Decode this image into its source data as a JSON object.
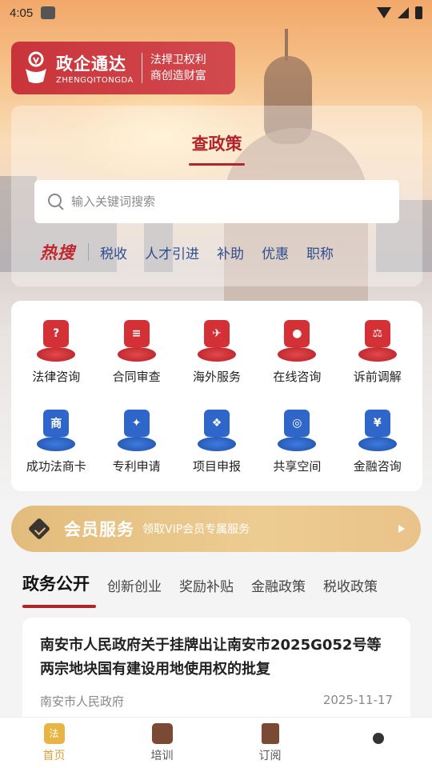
{
  "status": {
    "time": "4:05"
  },
  "logo": {
    "title": "政企通达",
    "pinyin": "ZHENGQITONGDA",
    "slogan_1": "法捍卫权利",
    "slogan_2": "商创造财富"
  },
  "policy": {
    "title": "查政策",
    "search_placeholder": "输入关键词搜索",
    "hot_label": "热搜",
    "hot_items": [
      "税收",
      "人才引进",
      "补助",
      "优惠",
      "职称"
    ]
  },
  "services": [
    {
      "label": "法律咨询",
      "icon": "law-consult-icon",
      "color": "red",
      "glyph": "?"
    },
    {
      "label": "合同审查",
      "icon": "contract-review-icon",
      "color": "red",
      "glyph": "≡"
    },
    {
      "label": "海外服务",
      "icon": "overseas-plane-icon",
      "color": "red",
      "glyph": "✈"
    },
    {
      "label": "在线咨询",
      "icon": "online-consult-icon",
      "color": "red",
      "glyph": "●"
    },
    {
      "label": "诉前调解",
      "icon": "gavel-icon",
      "color": "red",
      "glyph": "⚖"
    },
    {
      "label": "成功法商卡",
      "icon": "merchant-card-icon",
      "color": "blue",
      "glyph": "商"
    },
    {
      "label": "专利申请",
      "icon": "patent-icon",
      "color": "blue",
      "glyph": "✦"
    },
    {
      "label": "项目申报",
      "icon": "project-icon",
      "color": "blue",
      "glyph": "❖"
    },
    {
      "label": "共享空间",
      "icon": "shared-space-icon",
      "color": "blue",
      "glyph": "◎"
    },
    {
      "label": "金融咨询",
      "icon": "finance-icon",
      "color": "blue",
      "glyph": "¥"
    }
  ],
  "member": {
    "title": "会员服务",
    "subtitle": "领取VIP会员专属服务"
  },
  "tabs": [
    "政务公开",
    "创新创业",
    "奖励补贴",
    "金融政策",
    "税收政策"
  ],
  "article": {
    "title": "南安市人民政府关于挂牌出让南安市2025G052号等两宗地块国有建设用地使用权的批复",
    "source": "南安市人民政府",
    "date": "2025-11-17"
  },
  "nav": [
    {
      "label": "首页",
      "icon": "home-icon",
      "active": true
    },
    {
      "label": "培训",
      "icon": "training-icon",
      "active": false
    },
    {
      "label": "订阅",
      "icon": "subscribe-icon",
      "active": false
    },
    {
      "label": "",
      "icon": "profile-icon",
      "active": false
    }
  ],
  "colors": {
    "brand_red": "#c8343a",
    "gold": "#e2bc7c",
    "nav_active": "#d9a23a",
    "blue": "#2f66c9"
  }
}
